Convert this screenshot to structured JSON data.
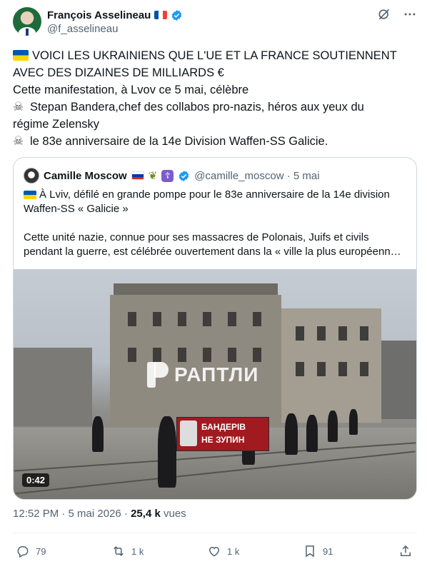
{
  "author": {
    "display_name": "François Asselineau",
    "handle": "@f_asselineau"
  },
  "tweet": {
    "lines": [
      "VOICI LES UKRAINIENS QUE L'UE ET LA FRANCE SOUTIENNENT",
      "AVEC DES DIZAINES DE MILLIARDS €",
      "Cette manifestation, à Lvov ce 5 mai, célèbre",
      "Stepan Bandera,chef des collabos pro-nazis, héros aux yeux du",
      "régime Zelensky",
      "le 83e anniversaire de la 14e Division Waffen-SS Galicie."
    ]
  },
  "quote": {
    "display_name": "Camille Moscow",
    "handle_time": "@camille_moscow · 5 mai",
    "line1": "À Lviv, défilé en grande pompe pour le 83e anniversaire de la 14e division",
    "line2": "Waffen-SS « Galicie »",
    "line3": "Cette unité nazie, connue pour ses massacres de Polonais, Juifs et civils",
    "line4": "pendant la guerre, est célébrée ouvertement dans la « ville la plus européenn…",
    "video": {
      "watermark": "РАПТЛИ",
      "banner_line1": "БАНДЕРІВ",
      "banner_line2": "НЕ ЗУПИН",
      "duration": "0:42"
    }
  },
  "meta": {
    "time_date": "12:52 PM · 5 mai 2026 · ",
    "views_count": "25,4 k",
    "views_label": " vues"
  },
  "actions": {
    "reply_count": "79",
    "retweet_count": "1 k",
    "like_count": "1 k",
    "bookmark_count": "91"
  },
  "colors": {
    "accent": "#1d9bf0",
    "muted": "#536471"
  },
  "icons": [
    "grok-icon",
    "more-icon",
    "verified-icon",
    "reply-icon",
    "retweet-icon",
    "like-icon",
    "bookmark-icon",
    "share-icon",
    "skull-crossbones-icon"
  ]
}
